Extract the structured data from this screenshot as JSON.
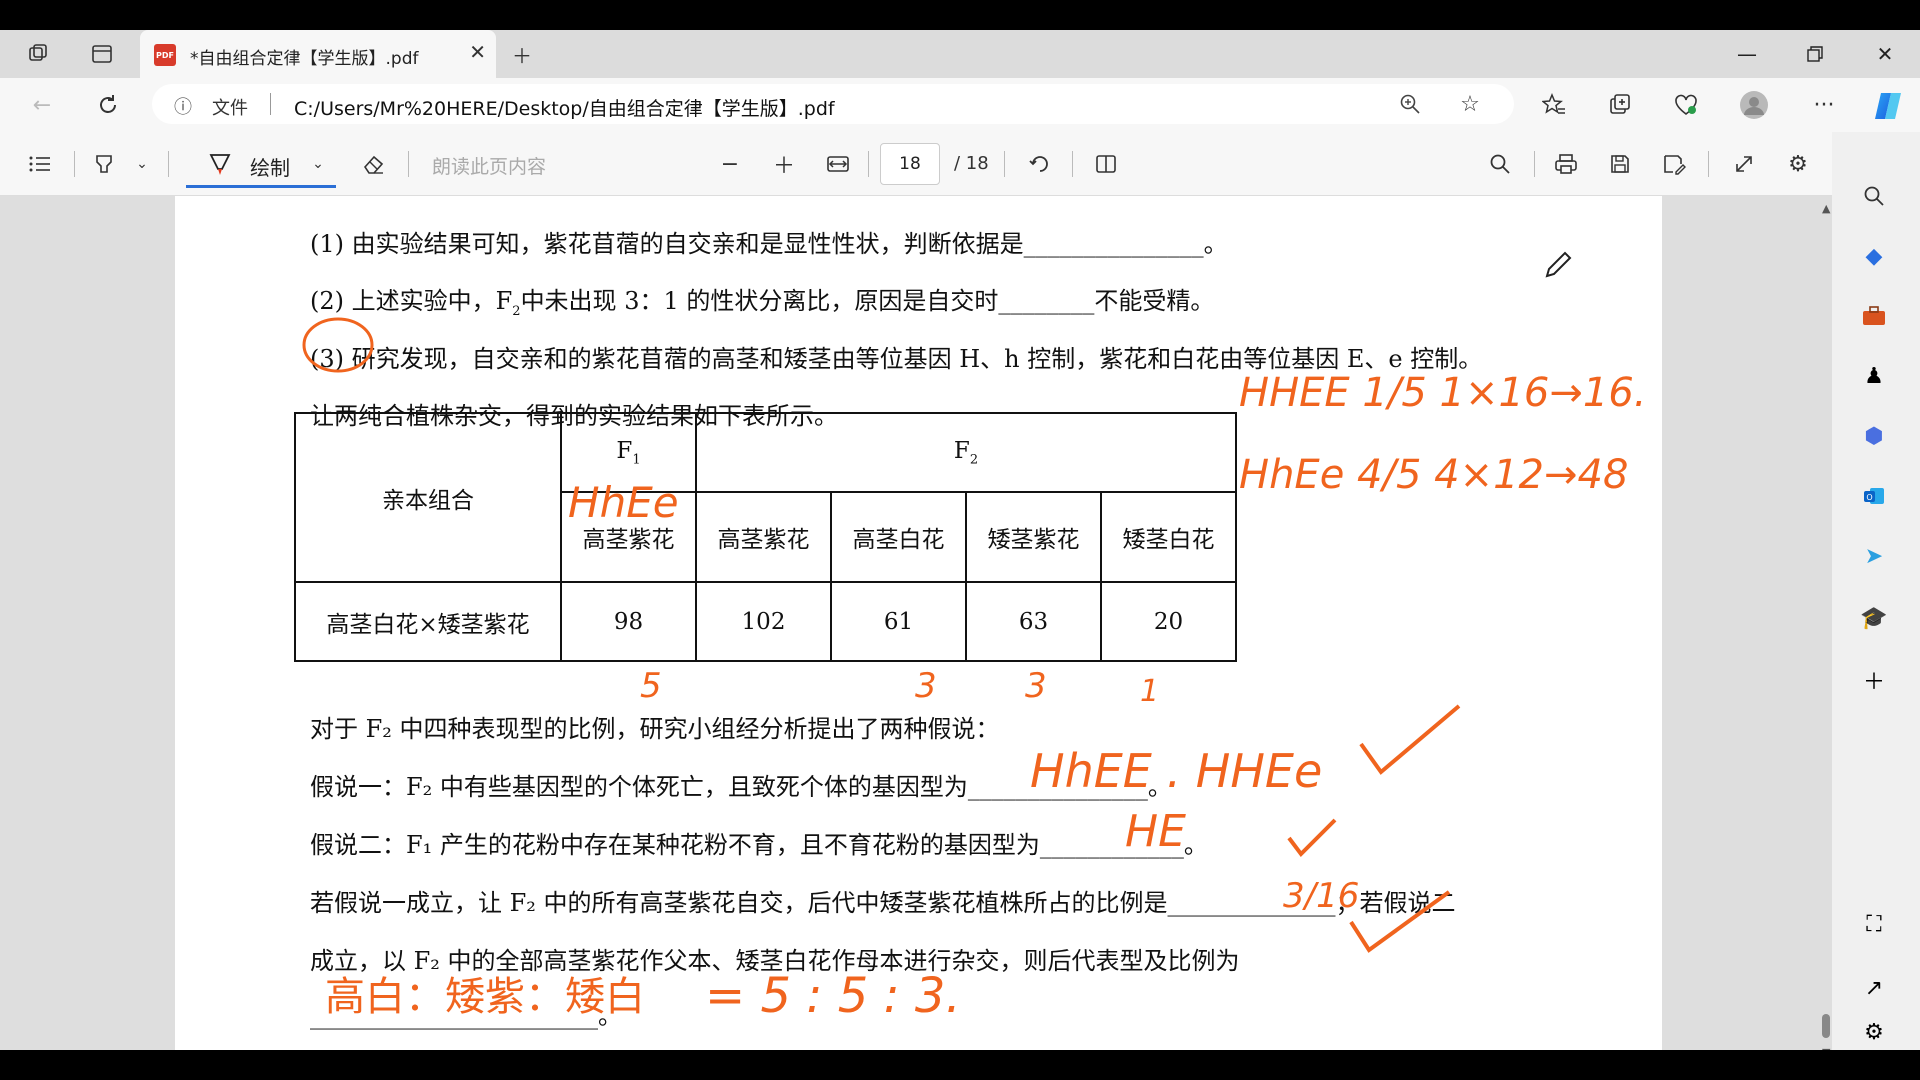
{
  "browser": {
    "tab_title": "*自由组合定律【学生版】.pdf",
    "file_label": "文件",
    "url": "C:/Users/Mr%20HERE/Desktop/自由组合定律【学生版】.pdf"
  },
  "pdf_toolbar": {
    "draw_label": "绘制",
    "read_aloud_label": "朗读此页内容",
    "page_current": "18",
    "page_total": "/ 18"
  },
  "document": {
    "q1": "(1) 由实验结果可知，紫花苜蓿的自交亲和是显性性状，判断依据是_______________。",
    "q2_pre": "(2) 上述实验中，F",
    "q2_sub": "2",
    "q2_post": "中未出现 3：1 的性状分离比，原因是自交时________不能受精。",
    "q3_line1": "(3) 研究发现，自交亲和的紫花苜蓿的高茎和矮茎由等位基因 H、h 控制，紫花和白花由等位基因 E、e 控制。",
    "q3_line2": "让两纯合植株杂交，得到的实验结果如下表所示。",
    "table": {
      "parent_header": "亲本组合",
      "f1_header": "F",
      "f1_sub": "1",
      "f2_header": "F",
      "f2_sub": "2",
      "col_f1": "高茎紫花",
      "cols_f2": [
        "高茎紫花",
        "高茎白花",
        "矮茎紫花",
        "矮茎白花"
      ],
      "row_label": "高茎白花×矮茎紫花",
      "row_values": [
        "98",
        "102",
        "61",
        "63",
        "20"
      ]
    },
    "p1": "对于 F₂ 中四种表现型的比例，研究小组经分析提出了两种假说：",
    "hyp1": "假说一：F₂ 中有些基因型的个体死亡，且致死个体的基因型为_______________。",
    "hyp2": "假说二：F₁ 产生的花粉中存在某种花粉不育，且不育花粉的基因型为____________。",
    "p2": "若假说一成立，让 F₂ 中的所有高茎紫花自交，后代中矮茎紫花植株所占的比例是______________；若假说二",
    "p3": "成立，以 F₂ 中的全部高茎紫花作父本、矮茎白花作母本进行杂交，则后代表型及比例为",
    "p4_blank": "________________________。"
  },
  "annotations": {
    "a1": "HHEE 1/5 1×16→16.",
    "a2": "HhEe 4/5 4×12→48",
    "table_f1": "HhEe",
    "under_counts": [
      "5",
      "3",
      "3",
      "1"
    ],
    "hyp1_answer": "HhEE . HHEe",
    "hyp2_answer": "HE",
    "frac": "3/16",
    "last_answer_words": "高白：矮紫：矮白",
    "last_answer_ratio": "= 5 : 5 : 3."
  },
  "colors": {
    "ink": "#f0641e",
    "accent": "#2b6fd6"
  }
}
